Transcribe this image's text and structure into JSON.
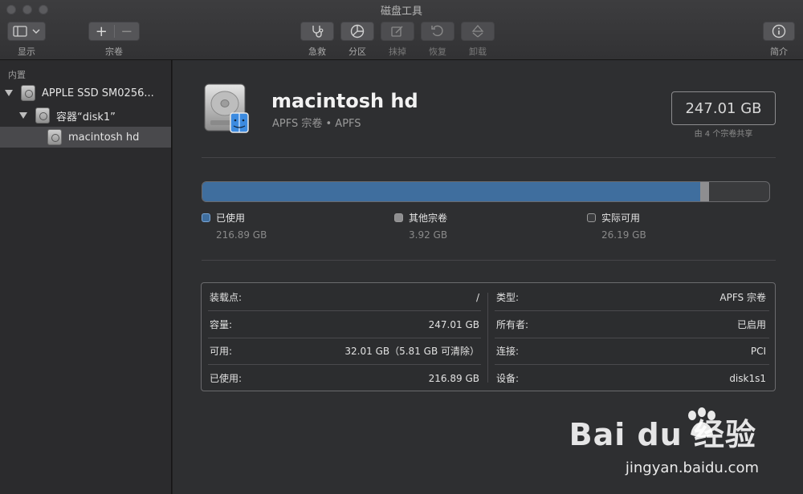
{
  "window": {
    "title": "磁盘工具"
  },
  "toolbar": {
    "view_label": "显示",
    "volume_label": "宗卷",
    "first_aid_label": "急救",
    "partition_label": "分区",
    "erase_label": "抹掉",
    "restore_label": "恢复",
    "unmount_label": "卸载",
    "info_label": "简介"
  },
  "sidebar": {
    "section_header": "内置",
    "items": [
      {
        "label": "APPLE SSD SM0256..."
      },
      {
        "label": "容器“disk1”"
      },
      {
        "label": "macintosh hd"
      }
    ]
  },
  "volume": {
    "name": "macintosh hd",
    "subtitle": "APFS 宗卷 • APFS",
    "capacity": "247.01 GB",
    "shared_note": "由 4 个宗卷共享"
  },
  "usage": {
    "used_fraction": 0.8781,
    "other_fraction": 0.0159,
    "free_fraction": 0.106,
    "colors": {
      "used": "#3f6e9e",
      "other": "#8e8e90",
      "free": "#3a3b3d"
    },
    "legend": [
      {
        "label": "已使用",
        "value": "216.89 GB"
      },
      {
        "label": "其他宗卷",
        "value": "3.92 GB"
      },
      {
        "label": "实际可用",
        "value": "26.19 GB"
      }
    ]
  },
  "info": {
    "left": [
      {
        "key": "装载点:",
        "value": "/"
      },
      {
        "key": "容量:",
        "value": "247.01 GB"
      },
      {
        "key": "可用:",
        "value": "32.01 GB（5.81 GB 可清除）"
      },
      {
        "key": "已使用:",
        "value": "216.89 GB"
      }
    ],
    "right": [
      {
        "key": "类型:",
        "value": "APFS 宗卷"
      },
      {
        "key": "所有者:",
        "value": "已启用"
      },
      {
        "key": "连接:",
        "value": "PCI"
      },
      {
        "key": "设备:",
        "value": "disk1s1"
      }
    ]
  },
  "watermark": {
    "brand": "Bai du 经验",
    "url": "jingyan.baidu.com"
  }
}
